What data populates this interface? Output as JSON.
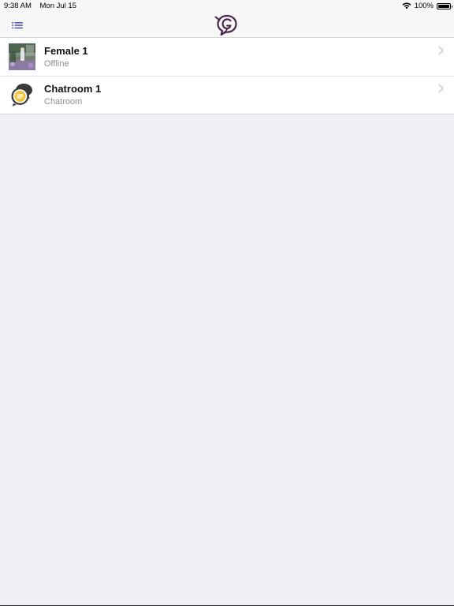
{
  "status_bar": {
    "time": "9:38 AM",
    "date": "Mon Jul 15",
    "battery_text": "100%",
    "battery_level": 1.0,
    "icons": [
      "wifi-icon",
      "battery-icon"
    ]
  },
  "nav_bar": {
    "menu_icon": "list-icon",
    "logo_icon": "chat-bubble-g-logo",
    "accent_color": "#4a2349",
    "menu_color": "#5b5cb8"
  },
  "conversations": [
    {
      "title": "Female 1",
      "subtitle": "Offline",
      "avatar_icon": "photo-avatar"
    },
    {
      "title": "Chatroom 1",
      "subtitle": "Chatroom",
      "avatar_icon": "chatroom-bubbles-icon"
    }
  ],
  "colors": {
    "background": "#efeff4",
    "subtitle": "#8e8e93",
    "chevron": "#c7c7cc",
    "chatroom_yellow": "#f4c430"
  }
}
